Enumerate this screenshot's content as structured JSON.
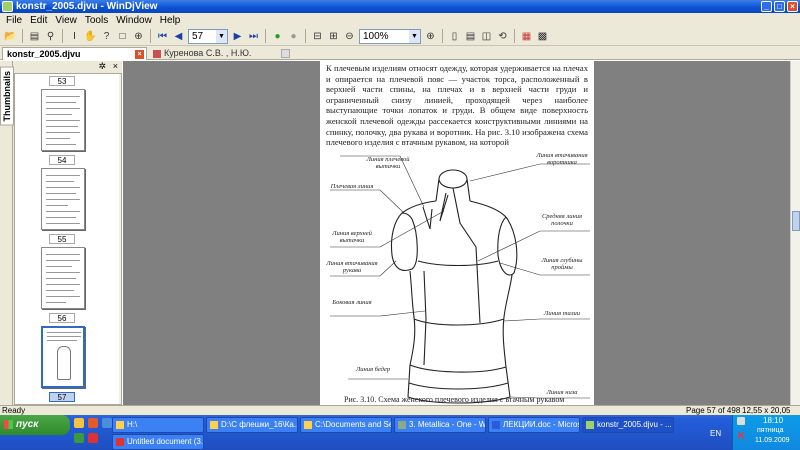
{
  "window": {
    "title": "konstr_2005.djvu - WinDjView"
  },
  "menu": [
    "File",
    "Edit",
    "View",
    "Tools",
    "Window",
    "Help"
  ],
  "toolbar": {
    "page_number": "57",
    "zoom": "100%"
  },
  "tabs": [
    {
      "label": "konstr_2005.djvu"
    },
    {
      "label": "Куренова С.В. , Н.Ю. Савельева - Конст..."
    }
  ],
  "sidebar": {
    "tab_label": "Thumbnails",
    "thumb_labels": [
      "53",
      "54",
      "55",
      "56",
      "57"
    ],
    "selected": "57"
  },
  "document": {
    "paragraph": "К плечевым изделиям относят одежду, которая удерживается на плечах и опирается на плечевой пояс — участок торса, расположенный в верхней части спины, на плечах и в верхней части груди и ограниченный снизу линией, проходящей через наиболее выступающие точки лопаток и груди. В общем виде поверхность женской плечевой одежды рассекается конструктивными линиями на спинку, полочку, два рукава и воротник. На рис. 3.10 изображена схема плечевого изделия с втачным рукавом, на которой",
    "caption": "Рис. 3.10. Схема женского плечевого изделия с втачным рукавом",
    "labels": {
      "l1": "Линия плечевой вытачки",
      "l2": "Плечевая линия",
      "l3": "Линия верхней вытачки",
      "l4": "Линия втачивания рукава",
      "l5": "Боковая линия",
      "l6": "Линия бедер",
      "r1": "Линия втачивания воротника",
      "r2": "Средняя линия полочки",
      "r3": "Линия глубины проймы",
      "r4": "Линия талии",
      "r5": "Линия низа"
    }
  },
  "status": {
    "left": "Ready",
    "page": "Page 57 of 498",
    "size": "12,55 x 20,05 cm"
  },
  "taskbar": {
    "start": "пуск",
    "tasks": [
      "H:\\",
      "D:\\С флешки_16\\Ка...",
      "C:\\Documents and Se...",
      "3. Metallica - One - W...",
      "ЛЕКЦИИ.doc - Micros...",
      "konstr_2005.djvu - ...",
      "Untitled document (3..."
    ],
    "lang": "EN",
    "time": "18:10",
    "day": "пятница",
    "date": "11.09.2009"
  }
}
